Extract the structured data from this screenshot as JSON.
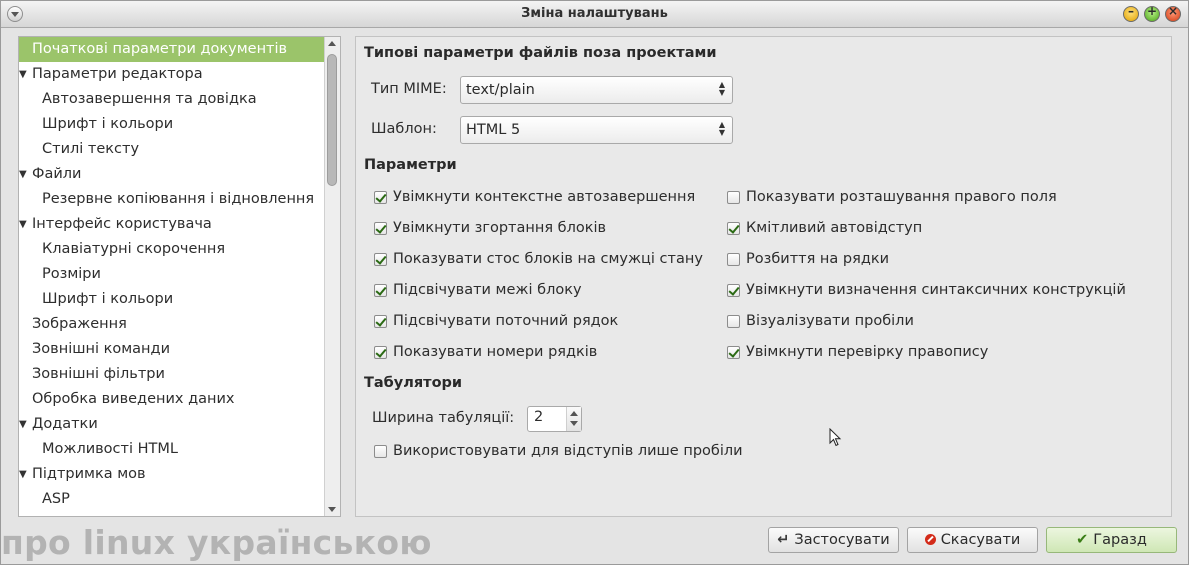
{
  "window": {
    "title": "Зміна налаштувань"
  },
  "sidebar": {
    "items": [
      {
        "label": "Початкові параметри документів",
        "level": 0,
        "expander": false,
        "selected": true
      },
      {
        "label": "Параметри редактора",
        "level": 0,
        "expander": true,
        "selected": false
      },
      {
        "label": "Автозавершення та довідка",
        "level": 1,
        "expander": false,
        "selected": false
      },
      {
        "label": "Шрифт і кольори",
        "level": 1,
        "expander": false,
        "selected": false
      },
      {
        "label": "Стилі тексту",
        "level": 1,
        "expander": false,
        "selected": false
      },
      {
        "label": "Файли",
        "level": 0,
        "expander": true,
        "selected": false
      },
      {
        "label": "Резервне копіювання і відновлення",
        "level": 1,
        "expander": false,
        "selected": false
      },
      {
        "label": "Інтерфейс користувача",
        "level": 0,
        "expander": true,
        "selected": false
      },
      {
        "label": "Клавіатурні скорочення",
        "level": 1,
        "expander": false,
        "selected": false
      },
      {
        "label": "Розміри",
        "level": 1,
        "expander": false,
        "selected": false
      },
      {
        "label": "Шрифт і кольори",
        "level": 1,
        "expander": false,
        "selected": false
      },
      {
        "label": "Зображення",
        "level": 0,
        "expander": false,
        "selected": false
      },
      {
        "label": "Зовнішні команди",
        "level": 0,
        "expander": false,
        "selected": false
      },
      {
        "label": "Зовнішні фільтри",
        "level": 0,
        "expander": false,
        "selected": false
      },
      {
        "label": "Обробка виведених даних",
        "level": 0,
        "expander": false,
        "selected": false
      },
      {
        "label": "Додатки",
        "level": 0,
        "expander": true,
        "selected": false
      },
      {
        "label": "Можливості HTML",
        "level": 1,
        "expander": false,
        "selected": false
      },
      {
        "label": "Підтримка мов",
        "level": 0,
        "expander": true,
        "selected": false
      },
      {
        "label": "ASP",
        "level": 1,
        "expander": false,
        "selected": false
      }
    ]
  },
  "main": {
    "section_file_defaults": "Типові параметри файлів поза проектами",
    "mime_label": "Тип MIME:",
    "mime_value": "text/plain",
    "template_label": "Шаблон:",
    "template_value": "HTML 5",
    "section_params": "Параметри",
    "checkboxes": [
      {
        "label": "Увімкнути контекстне автозавершення",
        "checked": true
      },
      {
        "label": "Увімкнути згортання блоків",
        "checked": true
      },
      {
        "label": "Показувати стос блоків на смужці стану",
        "checked": true
      },
      {
        "label": "Підсвічувати межі блоку",
        "checked": true
      },
      {
        "label": "Підсвічувати поточний рядок",
        "checked": true
      },
      {
        "label": "Показувати номери рядків",
        "checked": true
      },
      {
        "label": "Показувати розташування правого поля",
        "checked": false
      },
      {
        "label": "Кмітливий автовідступ",
        "checked": true
      },
      {
        "label": "Розбиття на рядки",
        "checked": false
      },
      {
        "label": "Увімкнути визначення синтаксичних конструкцій",
        "checked": true
      },
      {
        "label": "Візуалізувати пробіли",
        "checked": false
      },
      {
        "label": "Увімкнути перевірку правопису",
        "checked": true
      }
    ],
    "section_tabs": "Табулятори",
    "tab_width_label": "Ширина табуляції:",
    "tab_width_value": "2",
    "spaces_only_label": "Використовувати для відступів лише пробіли",
    "spaces_only_checked": false
  },
  "buttons": {
    "apply": "Застосувати",
    "cancel": "Скасувати",
    "ok": "Гаразд"
  },
  "watermark": "про linux українською",
  "colors": {
    "selection": "#9bc46a",
    "ok_button": "#d6ecbf",
    "cancel_icon": "#d32b1a"
  }
}
